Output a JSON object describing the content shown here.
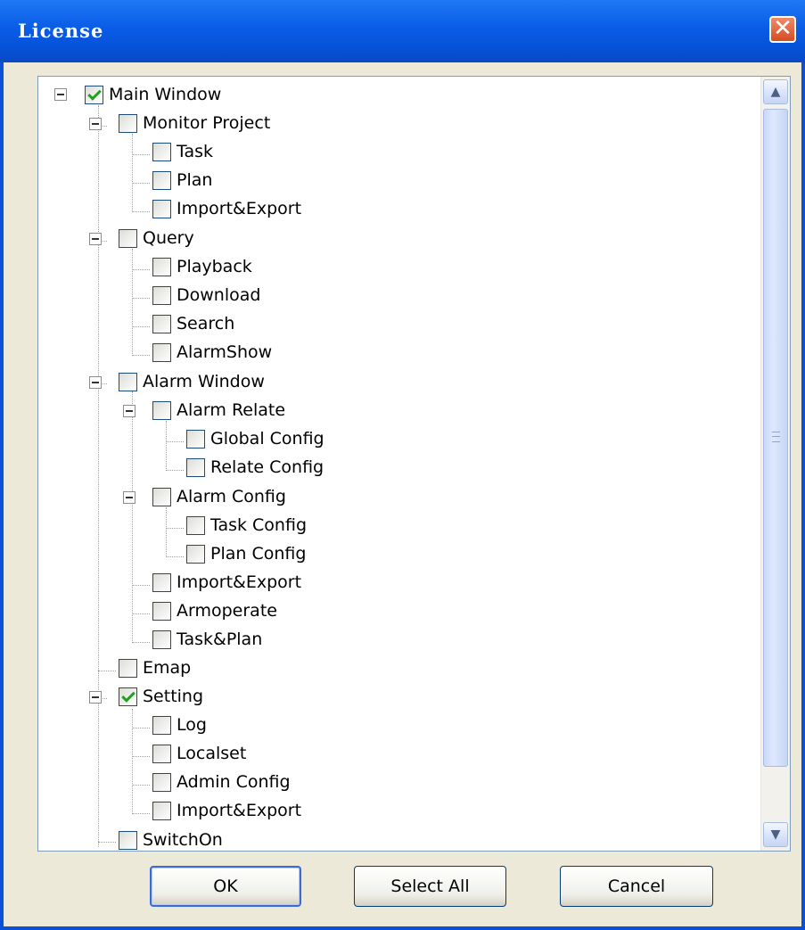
{
  "window": {
    "title": "License",
    "close_icon": "close-icon"
  },
  "tree": {
    "items": [
      {
        "label": "Main Window",
        "checked": true
      },
      {
        "label": "Monitor Project",
        "checked": false
      },
      {
        "label": "Task",
        "checked": false
      },
      {
        "label": "Plan",
        "checked": false
      },
      {
        "label": "Import&Export",
        "checked": false
      },
      {
        "label": "Query",
        "checked": false
      },
      {
        "label": "Playback",
        "checked": false
      },
      {
        "label": "Download",
        "checked": false
      },
      {
        "label": "Search",
        "checked": false
      },
      {
        "label": "AlarmShow",
        "checked": false
      },
      {
        "label": "Alarm Window",
        "checked": false
      },
      {
        "label": "Alarm Relate",
        "checked": false
      },
      {
        "label": "Global Config",
        "checked": false
      },
      {
        "label": "Relate Config",
        "checked": false
      },
      {
        "label": "Alarm Config",
        "checked": false
      },
      {
        "label": "Task Config",
        "checked": false
      },
      {
        "label": "Plan Config",
        "checked": false
      },
      {
        "label": "Import&Export",
        "checked": false
      },
      {
        "label": "Armoperate",
        "checked": false
      },
      {
        "label": "Task&Plan",
        "checked": false
      },
      {
        "label": "Emap",
        "checked": false
      },
      {
        "label": "Setting",
        "checked": true
      },
      {
        "label": "Log",
        "checked": false
      },
      {
        "label": "Localset",
        "checked": false
      },
      {
        "label": "Admin Config",
        "checked": false
      },
      {
        "label": "Import&Export",
        "checked": false
      },
      {
        "label": "SwitchOn",
        "checked": false
      }
    ]
  },
  "buttons": {
    "ok": "OK",
    "select_all": "Select All",
    "cancel": "Cancel"
  }
}
